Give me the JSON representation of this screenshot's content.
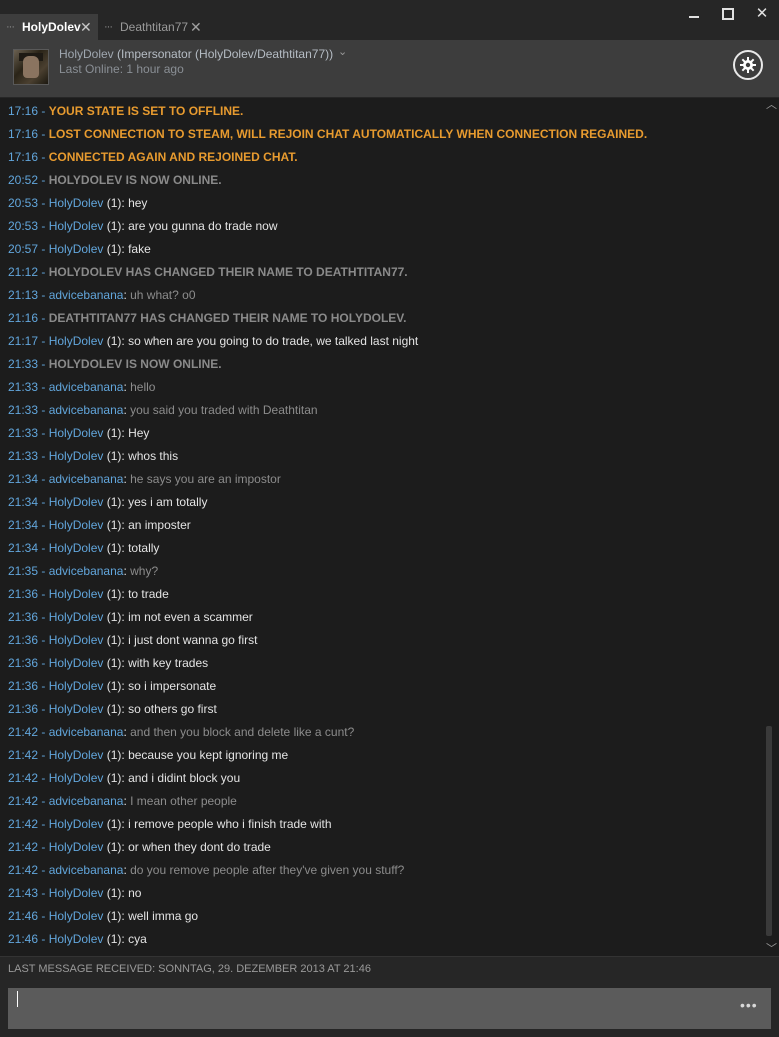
{
  "tabs": [
    {
      "label": "HolyDolev",
      "dots": "···",
      "close": "✕"
    },
    {
      "label": "Deathtitan77",
      "dots": "···",
      "close": "✕"
    }
  ],
  "window": {
    "close": "✕"
  },
  "header": {
    "name": "HolyDolev",
    "nick": "(Impersonator (HolyDolev/Deathtitan77))",
    "chevron": "⌄",
    "last_online": "Last Online: 1 hour ago"
  },
  "messages": [
    {
      "time": "17:16",
      "kind": "sys-orange",
      "text": "YOUR STATE IS SET TO OFFLINE."
    },
    {
      "time": "17:16",
      "kind": "sys-orange",
      "text": "LOST CONNECTION TO STEAM, WILL REJOIN CHAT AUTOMATICALLY WHEN CONNECTION REGAINED."
    },
    {
      "time": "17:16",
      "kind": "sys-orange",
      "text": "CONNECTED AGAIN AND REJOINED CHAT."
    },
    {
      "time": "20:52",
      "kind": "sys-gray",
      "text": "HOLYDOLEV IS NOW ONLINE."
    },
    {
      "time": "20:53",
      "kind": "them",
      "name": "HolyDolev",
      "count": "(1)",
      "text": "hey"
    },
    {
      "time": "20:53",
      "kind": "them",
      "name": "HolyDolev",
      "count": "(1)",
      "text": "are you gunna do trade now"
    },
    {
      "time": "20:57",
      "kind": "them",
      "name": "HolyDolev",
      "count": "(1)",
      "text": "fake"
    },
    {
      "time": "21:12",
      "kind": "sys-gray",
      "text": "HOLYDOLEV HAS CHANGED THEIR NAME TO DEATHTITAN77."
    },
    {
      "time": "21:13",
      "kind": "me",
      "name": "advicebanana",
      "text": "uh what? o0"
    },
    {
      "time": "21:16",
      "kind": "sys-gray",
      "text": "DEATHTITAN77 HAS CHANGED THEIR NAME TO HOLYDOLEV."
    },
    {
      "time": "21:17",
      "kind": "them",
      "name": "HolyDolev",
      "count": "(1)",
      "text": "so when are you going to do trade, we talked last night"
    },
    {
      "time": "21:33",
      "kind": "sys-gray",
      "text": "HOLYDOLEV IS NOW ONLINE."
    },
    {
      "time": "21:33",
      "kind": "me",
      "name": "advicebanana",
      "text": "hello"
    },
    {
      "time": "21:33",
      "kind": "me",
      "name": "advicebanana",
      "text": "you said you traded with Deathtitan"
    },
    {
      "time": "21:33",
      "kind": "them",
      "name": "HolyDolev",
      "count": "(1)",
      "text": "Hey"
    },
    {
      "time": "21:33",
      "kind": "them",
      "name": "HolyDolev",
      "count": "(1)",
      "text": "whos this"
    },
    {
      "time": "21:34",
      "kind": "me",
      "name": "advicebanana",
      "text": "he says you are an impostor"
    },
    {
      "time": "21:34",
      "kind": "them",
      "name": "HolyDolev",
      "count": "(1)",
      "text": "yes i am totally"
    },
    {
      "time": "21:34",
      "kind": "them",
      "name": "HolyDolev",
      "count": "(1)",
      "text": "an imposter"
    },
    {
      "time": "21:34",
      "kind": "them",
      "name": "HolyDolev",
      "count": "(1)",
      "text": "totally"
    },
    {
      "time": "21:35",
      "kind": "me",
      "name": "advicebanana",
      "text": "why?"
    },
    {
      "time": "21:36",
      "kind": "them",
      "name": "HolyDolev",
      "count": "(1)",
      "text": "to trade"
    },
    {
      "time": "21:36",
      "kind": "them",
      "name": "HolyDolev",
      "count": "(1)",
      "text": "im not even a scammer"
    },
    {
      "time": "21:36",
      "kind": "them",
      "name": "HolyDolev",
      "count": "(1)",
      "text": "i just dont wanna go first"
    },
    {
      "time": "21:36",
      "kind": "them",
      "name": "HolyDolev",
      "count": "(1)",
      "text": "with key trades"
    },
    {
      "time": "21:36",
      "kind": "them",
      "name": "HolyDolev",
      "count": "(1)",
      "text": "so i impersonate"
    },
    {
      "time": "21:36",
      "kind": "them",
      "name": "HolyDolev",
      "count": "(1)",
      "text": "so others go first"
    },
    {
      "time": "21:42",
      "kind": "me",
      "name": "advicebanana",
      "text": "and then you block and delete like a cunt?"
    },
    {
      "time": "21:42",
      "kind": "them",
      "name": "HolyDolev",
      "count": "(1)",
      "text": "because you kept ignoring me"
    },
    {
      "time": "21:42",
      "kind": "them",
      "name": "HolyDolev",
      "count": "(1)",
      "text": "and i didint block you"
    },
    {
      "time": "21:42",
      "kind": "me",
      "name": "advicebanana",
      "text": "I mean other people"
    },
    {
      "time": "21:42",
      "kind": "them",
      "name": "HolyDolev",
      "count": "(1)",
      "text": "i remove people who i finish trade with"
    },
    {
      "time": "21:42",
      "kind": "them",
      "name": "HolyDolev",
      "count": "(1)",
      "text": "or when they dont do trade"
    },
    {
      "time": "21:42",
      "kind": "me",
      "name": "advicebanana",
      "text": "do you remove people after  they've given you stuff?"
    },
    {
      "time": "21:43",
      "kind": "them",
      "name": "HolyDolev",
      "count": "(1)",
      "text": "no"
    },
    {
      "time": "21:46",
      "kind": "them",
      "name": "HolyDolev",
      "count": "(1)",
      "text": "well imma go"
    },
    {
      "time": "21:46",
      "kind": "them",
      "name": "HolyDolev",
      "count": "(1)",
      "text": "cya"
    }
  ],
  "status": {
    "text": "LAST MESSAGE RECEIVED: SONNTAG, 29. DEZEMBER 2013 AT 21:46"
  },
  "input": {
    "value": "",
    "more": "•••"
  },
  "colors": {
    "accent": "#62a6dc",
    "system_orange": "#e89b2f",
    "system_gray": "#8a8a8a",
    "chat_bg": "#1c1c1c"
  },
  "icons": [
    "gear-icon",
    "chevron-down-icon",
    "close-icon",
    "minimize-icon",
    "maximize-icon",
    "scroll-up-icon",
    "scroll-down-icon"
  ]
}
